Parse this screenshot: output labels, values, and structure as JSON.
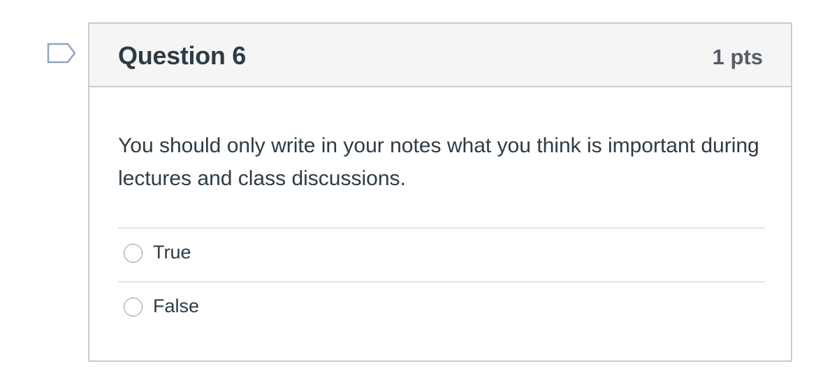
{
  "question": {
    "title": "Question 6",
    "points": "1 pts",
    "text": "You should only write in your notes what you think is important during lectures and class discussions.",
    "flag_icon": "flag-question-icon",
    "answers": [
      {
        "label": "True",
        "selected": false
      },
      {
        "label": "False",
        "selected": false
      }
    ]
  },
  "colors": {
    "border": "#c7cdd1",
    "header_bg": "#f5f5f5",
    "text": "#2d3b45",
    "flag": "#8fa5c0"
  }
}
